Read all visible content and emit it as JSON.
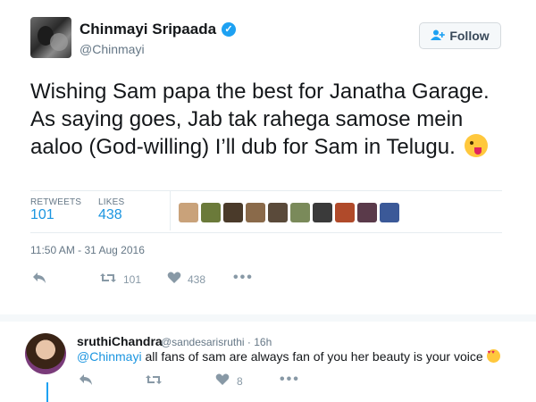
{
  "tweet": {
    "author_name": "Chinmayi Sripaada",
    "author_handle": "@Chinmayi",
    "follow_label": "Follow",
    "text": "Wishing Sam papa the best for Janatha Garage. As saying goes, Jab tak rahega samose mein aaloo (God-willing) I’ll dub for Sam in Telugu.",
    "stats": {
      "retweets_label": "RETWEETS",
      "retweets": "101",
      "likes_label": "LIKES",
      "likes": "438"
    },
    "timestamp": "11:50 AM - 31 Aug 2016",
    "actions": {
      "retweet_count": "101",
      "like_count": "438"
    },
    "liker_colors": [
      "#c9a27a",
      "#6b7a3a",
      "#4a3a2a",
      "#8a6a4a",
      "#5a4a3a",
      "#7a8a5a",
      "#3a3a3a",
      "#b04a2a",
      "#5a3a4a",
      "#3b5998"
    ]
  },
  "reply": {
    "author_name": "sruthiChandra",
    "author_handle": "@sandesarisruthi",
    "time": "16h",
    "mention": "@Chinmayi",
    "text": " all fans of sam are always fan of you her beauty is your voice",
    "like_count": "8"
  },
  "icons": {
    "verified": "verified-badge-icon",
    "follow": "follow-person-icon",
    "reply": "reply-icon",
    "retweet": "retweet-icon",
    "like": "heart-icon",
    "more": "more-dots-icon",
    "emoji_wink": "winking-tongue-emoji-icon",
    "emoji_love": "heart-eyes-emoji-icon"
  },
  "colors": {
    "accent": "#1da1f2",
    "link": "#1b95e0",
    "muted": "#657786"
  }
}
